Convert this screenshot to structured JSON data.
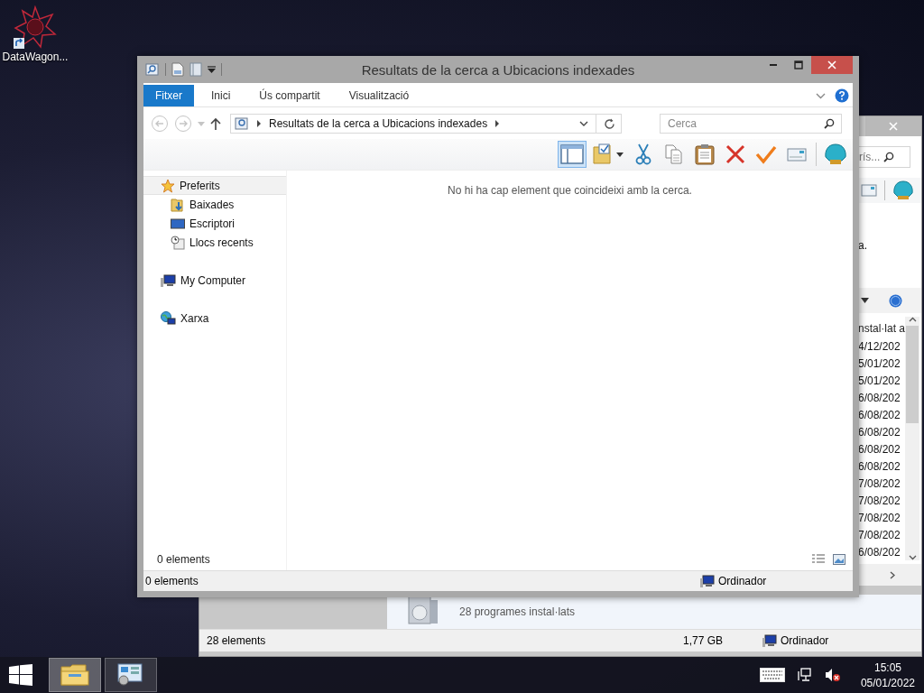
{
  "desktop_icons": [
    {
      "label": "DataWagon..."
    }
  ],
  "back_window": {
    "search": {
      "placeholder": "rís..."
    },
    "text": "a.",
    "column_header": "nstal·lat a",
    "dates": [
      "4/12/202",
      "5/01/202",
      "5/01/202",
      "6/08/202",
      "6/08/202",
      "6/08/202",
      "6/08/202",
      "6/08/202",
      "7/08/202",
      "7/08/202",
      "7/08/202",
      "7/08/202",
      "6/08/202"
    ],
    "summary": "28 programes instal·lats",
    "status_bar": {
      "items": "28 elements",
      "size": "1,77 GB",
      "location": "Ordinador"
    }
  },
  "window": {
    "title": "Resultats de la cerca a Ubicacions indexades",
    "tabs": [
      {
        "label": "Fitxer",
        "selected": true
      },
      {
        "label": "Inici",
        "selected": false
      },
      {
        "label": "Ús compartit",
        "selected": false
      },
      {
        "label": "Visualització",
        "selected": false
      }
    ],
    "address": {
      "path": "Resultats de la cerca a Ubicacions indexades"
    },
    "search": {
      "placeholder": "Cerca"
    },
    "preview_pane": {
      "on": true
    },
    "toolbar": [
      {
        "kind": "folder"
      },
      {
        "kind": "cut"
      },
      {
        "kind": "copy"
      },
      {
        "kind": "paste"
      },
      {
        "kind": "delete"
      },
      {
        "kind": "check"
      },
      {
        "kind": "card"
      },
      {
        "kind": "shell"
      }
    ],
    "nav": [
      {
        "label": "Preferits",
        "kind": "star",
        "selected": true,
        "children": [
          {
            "label": "Baixades",
            "kind": "downloads",
            "selected": false
          },
          {
            "label": "Escriptori",
            "kind": "desktop",
            "selected": false
          },
          {
            "label": "Llocs recents",
            "kind": "recent",
            "selected": false
          }
        ]
      },
      {
        "label": "My Computer",
        "kind": "computer",
        "selected": false
      },
      {
        "label": "Xarxa",
        "kind": "network",
        "selected": false
      }
    ],
    "empty_message": "No hi ha cap element que coincideixi amb la cerca.",
    "item_count": "0 elements",
    "status_bar": {
      "items": "0 elements",
      "location": "Ordinador"
    }
  },
  "taskbar": {
    "buttons": [
      {
        "kind": "explorer",
        "selected": true
      },
      {
        "kind": "control-panel",
        "selected": false
      }
    ],
    "time": "15:05",
    "date": "05/01/2022"
  }
}
